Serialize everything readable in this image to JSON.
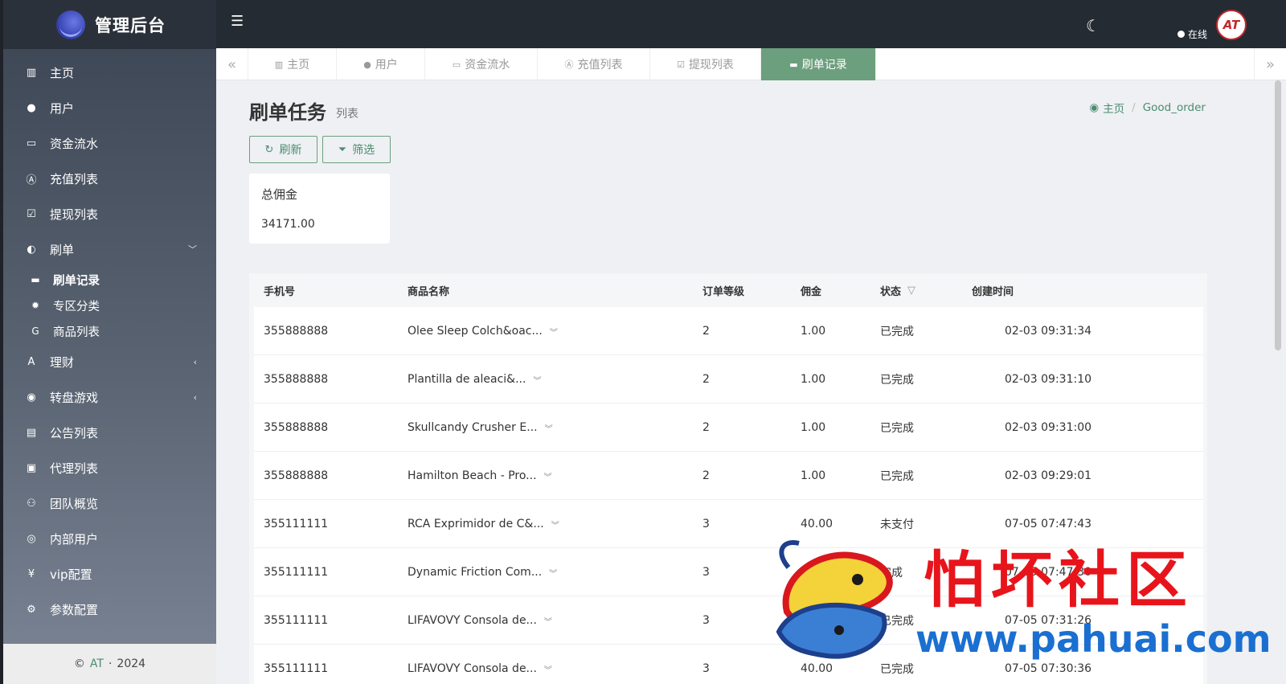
{
  "brand": {
    "title": "管理后台"
  },
  "sidebar": {
    "items": [
      {
        "label": "主页",
        "icon": "bar-chart-icon"
      },
      {
        "label": "用户",
        "icon": "user-icon"
      },
      {
        "label": "资金流水",
        "icon": "money-icon"
      },
      {
        "label": "充值列表",
        "icon": "a-square-icon"
      },
      {
        "label": "提现列表",
        "icon": "check-square-icon"
      },
      {
        "label": "刷单",
        "icon": "half-circle-icon",
        "expanded": true
      },
      {
        "label": "理财",
        "icon": "finance-icon"
      },
      {
        "label": "转盘游戏",
        "icon": "gamepad-icon"
      },
      {
        "label": "公告列表",
        "icon": "document-icon"
      },
      {
        "label": "代理列表",
        "icon": "contact-icon"
      },
      {
        "label": "团队概览",
        "icon": "users-icon"
      },
      {
        "label": "内部用户",
        "icon": "user-circle-icon"
      },
      {
        "label": "vip配置",
        "icon": "yen-icon"
      },
      {
        "label": "参数配置",
        "icon": "gears-icon"
      }
    ],
    "sub_items": [
      {
        "label": "刷单记录",
        "icon": "keyboard-icon",
        "active": true
      },
      {
        "label": "专区分类",
        "icon": "gear-icon"
      },
      {
        "label": "商品列表",
        "icon": "g-icon"
      }
    ],
    "footer": {
      "copyright": "©",
      "brand": "AT",
      "separator": "·",
      "year": "2024"
    }
  },
  "topbar": {
    "status": "在线",
    "avatar_text": "AT"
  },
  "tabs": [
    {
      "label": "主页",
      "icon": "bar-chart-icon"
    },
    {
      "label": "用户",
      "icon": "user-icon"
    },
    {
      "label": "资金流水",
      "icon": "money-icon"
    },
    {
      "label": "充值列表",
      "icon": "a-square-icon"
    },
    {
      "label": "提现列表",
      "icon": "check-square-icon"
    },
    {
      "label": "刷单记录",
      "icon": "keyboard-icon",
      "active": true
    }
  ],
  "page": {
    "title": "刷单任务",
    "subtitle": "列表",
    "breadcrumb": {
      "home": "主页",
      "separator": "/",
      "current": "Good_order"
    },
    "buttons": {
      "refresh": "刷新",
      "filter": "筛选"
    },
    "summary": {
      "label": "总佣金",
      "value": "34171.00"
    }
  },
  "table": {
    "headers": {
      "phone": "手机号",
      "product": "商品名称",
      "level": "订单等级",
      "commission": "佣金",
      "status": "状态",
      "created": "创建时间"
    },
    "rows": [
      {
        "phone": "355888888",
        "product": "Olee Sleep Colch&oac...",
        "level": "2",
        "commission": "1.00",
        "status": "已完成",
        "created": "02-03 09:31:34"
      },
      {
        "phone": "355888888",
        "product": "Plantilla de aleaci&...",
        "level": "2",
        "commission": "1.00",
        "status": "已完成",
        "created": "02-03 09:31:10"
      },
      {
        "phone": "355888888",
        "product": "Skullcandy Crusher E...",
        "level": "2",
        "commission": "1.00",
        "status": "已完成",
        "created": "02-03 09:31:00"
      },
      {
        "phone": "355888888",
        "product": "Hamilton Beach - Pro...",
        "level": "2",
        "commission": "1.00",
        "status": "已完成",
        "created": "02-03 09:29:01"
      },
      {
        "phone": "355111111",
        "product": "RCA Exprimidor de C&...",
        "level": "3",
        "commission": "40.00",
        "status": "未支付",
        "created": "07-05 07:47:43"
      },
      {
        "phone": "355111111",
        "product": "Dynamic Friction Com...",
        "level": "3",
        "commission": "",
        "status": "完成",
        "created": "07-05 07:47:30"
      },
      {
        "phone": "355111111",
        "product": "LIFAVOVY Consola de...",
        "level": "3",
        "commission": "",
        "status": "已完成",
        "created": "07-05 07:31:26"
      },
      {
        "phone": "355111111",
        "product": "LIFAVOVY Consola de...",
        "level": "3",
        "commission": "40.00",
        "status": "已完成",
        "created": "07-05 07:30:36"
      }
    ]
  },
  "watermark": {
    "text": "怕坏社区",
    "url": "www.pahuai.com"
  },
  "colors": {
    "accent": "#6c9f7d",
    "sidebar_top": "#3b4452",
    "topbar": "#252b33",
    "watermark_red": "#e8141b",
    "watermark_blue": "#1a6fd1"
  }
}
